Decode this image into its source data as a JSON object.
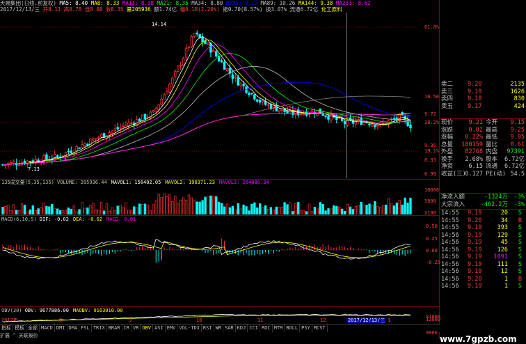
{
  "info": {
    "line1": [
      {
        "t": "天赐集团(日线,前复权)",
        "c": "#c0c0c0"
      },
      {
        "t": " MA5: 8.40",
        "c": "#ffffff"
      },
      {
        "t": " MA8: 8.33",
        "c": "#ffff00"
      },
      {
        "t": " MA13: 8.38",
        "c": "#ff00ff"
      },
      {
        "t": " MA21: 8.35",
        "c": "#00ff00"
      },
      {
        "t": " MA34: 8.80",
        "c": "#c0c0c0"
      },
      {
        "t": " MA55: 9.19",
        "c": "#0000ff"
      },
      {
        "t": " MA89: 10.26",
        "c": "#c0c0c0"
      },
      {
        "t": " MA144: 9.38",
        "c": "#ffff00"
      },
      {
        "t": " MA233: 8.62",
        "c": "#ff00ff"
      }
    ],
    "line2": [
      {
        "t": "2017/12/13/三",
        "c": "#c0c0c0"
      },
      {
        "t": " 开8.11",
        "c": "#ff4040"
      },
      {
        "t": " 高8.78",
        "c": "#ff4040"
      },
      {
        "t": " 低8.08",
        "c": "#ff4040"
      },
      {
        "t": " 收8.35",
        "c": "#ff4040"
      },
      {
        "t": " 量205936",
        "c": "#ffff00"
      },
      {
        "t": " 额1.74亿",
        "c": "#c0c0c0"
      },
      {
        "t": " 幅0.18(2.20%)",
        "c": "#ff4040"
      },
      {
        "t": " 振0.70(8.57%)",
        "c": "#c0c0c0"
      },
      {
        "t": " 换3.07%",
        "c": "#c0c0c0"
      },
      {
        "t": " 流通6.72亿",
        "c": "#c0c0c0"
      },
      {
        "t": " 化工原料",
        "c": "#ffff00"
      }
    ]
  },
  "price_axis": [
    "61.8%",
    "10.56",
    "9.72",
    "38.2%",
    "9.36",
    "19.1%",
    "8.33",
    "6.99"
  ],
  "price_annotations": {
    "high": "14.14",
    "low": "7.13"
  },
  "volume": {
    "label": "135成交量(5,35,135)",
    "items": [
      {
        "t": "VOLUME: 205936.44",
        "c": "#c0c0c0"
      },
      {
        "t": "MAVOL1: 156402.05",
        "c": "#ffffff"
      },
      {
        "t": "MAVOL2: 190371.23",
        "c": "#ffff00"
      },
      {
        "t": "MAVOL3: 264080.34",
        "c": "#ff00ff"
      }
    ],
    "axis": [
      "10000",
      "5000",
      "X100"
    ]
  },
  "macd": {
    "label": "MACD(6,10,5)",
    "items": [
      {
        "t": "DIF: -0.02",
        "c": "#ffffff"
      },
      {
        "t": "DEA: -0.02",
        "c": "#ffff00"
      },
      {
        "t": "MACD: 0.01",
        "c": "#ff00ff"
      }
    ],
    "axis": [
      "0.50",
      "0.25",
      "0.00",
      "-0.25"
    ]
  },
  "obv": {
    "label": "OBV(30)",
    "items": [
      {
        "t": "OBV: 9677886.00",
        "c": "#ffffff"
      },
      {
        "t": "MAOBV: 9163010.00",
        "c": "#ffff00"
      }
    ],
    "axis": [
      "12000",
      "9000",
      "X1000"
    ]
  },
  "date_axis": [
    "2017年",
    "8",
    "9",
    "10",
    "11",
    "12",
    "2017/12/13/三",
    "1"
  ],
  "order_book": [
    {
      "label": "卖二",
      "price": "9.20",
      "vol": "2135"
    },
    {
      "label": "卖三",
      "price": "9.19",
      "vol": "1626"
    },
    {
      "label": "卖四",
      "price": "9.18",
      "vol": "830"
    },
    {
      "label": "卖五",
      "price": "9.17",
      "vol": "424"
    }
  ],
  "quote": [
    {
      "l1": "现价",
      "v1": "9.21",
      "l2": "今开",
      "v2": "9.15"
    },
    {
      "l1": "涨跌",
      "v1": "0.02",
      "l2": "最高",
      "v2": "9.25"
    },
    {
      "l1": "涨幅",
      "v1": "0.22%",
      "l2": "最低",
      "v2": "9.05"
    },
    {
      "l1": "总量",
      "v1": "180159",
      "l2": "量比",
      "v2": "0.61"
    },
    {
      "l1": "外盘",
      "v1": "82768",
      "l2": "内盘",
      "v2": "97391"
    },
    {
      "l1": "换手",
      "v1": "2.68%",
      "l2": "股本",
      "v2": "6.72亿"
    },
    {
      "l1": "净资",
      "v1": "6.15",
      "l2": "流通",
      "v2": "6.72亿"
    },
    {
      "l1": "收益(三)",
      "v1": "0.127",
      "l2": "PE(动)",
      "v2": "54.5"
    }
  ],
  "flow": [
    {
      "label": "净流入额",
      "value": "-1324万",
      "pct": "-3%"
    },
    {
      "label": "大宗流入",
      "value": "-462.2万",
      "pct": "-3%"
    }
  ],
  "ticks": [
    {
      "time": "14:55",
      "price": "9.19",
      "vol": "20",
      "side": "S"
    },
    {
      "time": "14:55",
      "price": "9.20",
      "vol": "34",
      "side": "B"
    },
    {
      "time": "14:55",
      "price": "9.19",
      "vol": "393",
      "side": "S"
    },
    {
      "time": "14:56",
      "price": "9.19",
      "vol": "129",
      "side": "S"
    },
    {
      "time": "14:56",
      "price": "9.19",
      "vol": "45",
      "side": "S"
    },
    {
      "time": "14:56",
      "price": "9.19",
      "vol": "126",
      "side": "S"
    },
    {
      "time": "14:56",
      "price": "9.19",
      "vol": "1091",
      "side": "S"
    },
    {
      "time": "14:56",
      "price": "9.19",
      "vol": "111",
      "side": "S"
    },
    {
      "time": "14:56",
      "price": "9.19",
      "vol": "12",
      "side": "S"
    },
    {
      "time": "14:56",
      "price": "9.20",
      "vol": "1",
      "side": "B"
    },
    {
      "time": "14:56",
      "price": "9.19",
      "vol": "1",
      "side": "S"
    }
  ],
  "tabs": [
    "指标",
    "模板",
    "全部",
    "MACD",
    "DMI",
    "DMA",
    "FSL",
    "TRIX",
    "BRAR",
    "CR",
    "VR",
    "OBV",
    "ASI",
    "EMV",
    "VOL-TDX",
    "RSI",
    "WR",
    "SAR",
    "KDJ",
    "CCI",
    "ROC",
    "MTM",
    "BOLL",
    "PSY",
    "MCST"
  ],
  "active_tab": "OBV",
  "bottom_text": "扩展 ^  关联报价",
  "watermark": "www.7gpzb.com",
  "colors": {
    "up": "#ff3030",
    "down": "#00ffff",
    "bg": "#000000",
    "grid": "#800000"
  }
}
